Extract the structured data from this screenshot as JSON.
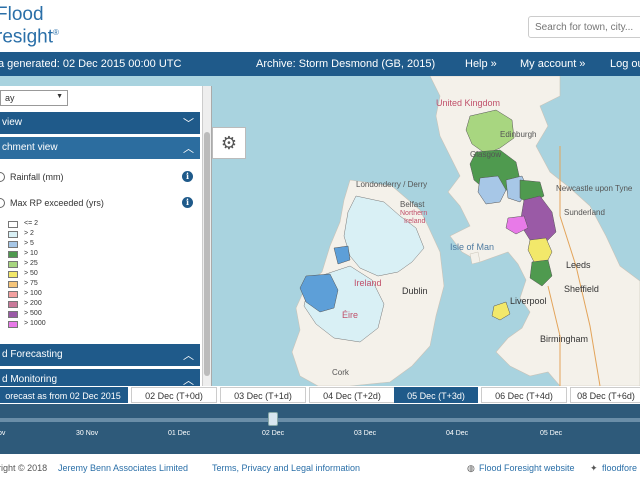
{
  "header": {
    "logo_line1": "Flood",
    "logo_line2": "resight",
    "logo_mark": "®",
    "search_placeholder": "Search for town, city..."
  },
  "navbar": {
    "generated": "a generated: 02 Dec 2015 00:00 UTC",
    "archive": "Archive: Storm Desmond (GB, 2015)",
    "help": "Help »",
    "account": "My account »",
    "logout": "Log ou"
  },
  "sidebar": {
    "select_value": "ay",
    "panel_view": "view",
    "panel_catchment": "chment view",
    "radio_rainfall": "Rainfall (mm)",
    "radio_maxrp": "Max RP exceeded (yrs)",
    "legend": [
      {
        "label": "<= 2",
        "color": "#ffffff"
      },
      {
        "label": "> 2",
        "color": "#d9f0f5"
      },
      {
        "label": "> 5",
        "color": "#a7c7e7"
      },
      {
        "label": "> 10",
        "color": "#4f9a4f"
      },
      {
        "label": "> 25",
        "color": "#a8d680"
      },
      {
        "label": "> 50",
        "color": "#f2e86a"
      },
      {
        "label": "> 75",
        "color": "#f5c57a"
      },
      {
        "label": "> 100",
        "color": "#f2a0a0"
      },
      {
        "label": "> 200",
        "color": "#c97a9a"
      },
      {
        "label": "> 500",
        "color": "#9a5aa6"
      },
      {
        "label": "> 1000",
        "color": "#e87ae8"
      }
    ],
    "panel_forecasting": "d Forecasting",
    "panel_monitoring": "d Monitoring"
  },
  "map_labels": {
    "uk": "United Kingdom",
    "edinburgh": "Edinburgh",
    "glasgow": "Glasgow",
    "newcastle": "Newcastle upon Tyne",
    "sunderland": "Sunderland",
    "londonderry": "Londonderry / Derry",
    "belfast": "Belfast",
    "ni1": "Northern",
    "ni2": "Ireland",
    "isle_of_man": "Isle of Man",
    "leeds": "Leeds",
    "sheffield": "Sheffield",
    "liverpool": "Liverpool",
    "dublin": "Dublin",
    "ireland1": "Ireland",
    "ireland2": "Éire",
    "birmingham": "Birmingham",
    "cork": "Cork"
  },
  "timeline": {
    "tabs": [
      "orecast as from 02 Dec 2015",
      "02 Dec (T+0d)",
      "03 Dec (T+1d)",
      "04 Dec (T+2d)",
      "05 Dec (T+3d)",
      "06 Dec (T+4d)",
      "08 Dec (T+6d)"
    ],
    "ticks": [
      "ov",
      "30 Nov",
      "01 Dec",
      "02 Dec",
      "03 Dec",
      "04 Dec",
      "05 Dec"
    ]
  },
  "footer": {
    "copyright": "right © 2018",
    "company": "Jeremy Benn Associates Limited",
    "terms": "Terms, Privacy and Legal information",
    "website": "Flood Foresight website",
    "twitter": "floodfore"
  },
  "colors": {
    "brand": "#1f5a8a",
    "sea": "#a9d3df",
    "land": "#f4f1ea"
  }
}
